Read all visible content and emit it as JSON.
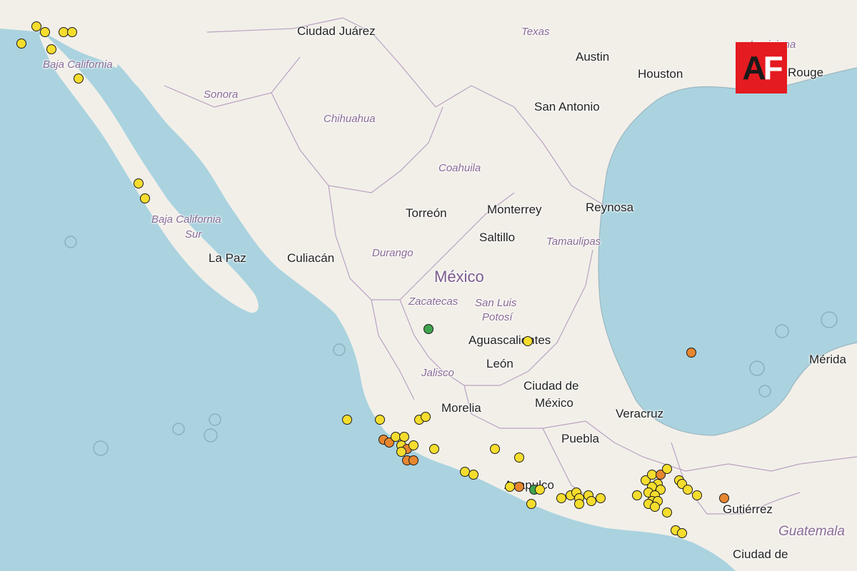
{
  "logo": {
    "text_a": "A",
    "text_f": "F",
    "color": "#e41b20"
  },
  "colors": {
    "water": "#aad3df",
    "land": "#f2efe9",
    "yellow": "#f5dd2e",
    "orange": "#e6862f",
    "green": "#3fa34d"
  },
  "labels": {
    "country_mexico": "México",
    "states": {
      "baja_california": "Baja California",
      "sonora": "Sonora",
      "chihuahua": "Chihuahua",
      "coahuila": "Coahuila",
      "texas": "Texas",
      "louisiana": "Louisiana",
      "baja_california_sur": "Baja California",
      "baja_california_sur_2": "Sur",
      "durango": "Durango",
      "tamaulipas": "Tamaulipas",
      "zacatecas": "Zacatecas",
      "san_luis_potosi": "San Luis",
      "san_luis_potosi_2": "Potosí",
      "jalisco": "Jalisco"
    },
    "cities": {
      "ciudad_juarez": "Ciudad Juárez",
      "austin": "Austin",
      "houston": "Houston",
      "baton_rouge": "Rouge",
      "san_antonio": "San Antonio",
      "torreon": "Torreón",
      "monterrey": "Monterrey",
      "reynosa": "Reynosa",
      "saltillo": "Saltillo",
      "la_paz": "La Paz",
      "culiacan": "Culiacán",
      "aguascalientes": "Aguascalientes",
      "leon": "León",
      "ciudad_de_mexico": "Ciudad de",
      "ciudad_de_mexico_2": "México",
      "morelia": "Morelia",
      "puebla": "Puebla",
      "veracruz": "Veracruz",
      "acapulco": "Acapulco",
      "merida": "Mérida",
      "tuxtla": "Gutiérrez",
      "guatemala": "Guatemala",
      "ciudad_de_guatemala": "Ciudad de"
    }
  },
  "earthquakes": [
    {
      "lat": 32.9,
      "lon": -115.8,
      "level": "yellow"
    },
    {
      "lat": 32.7,
      "lon": -115.5,
      "level": "yellow"
    },
    {
      "lat": 32.7,
      "lon": -114.9,
      "level": "yellow"
    },
    {
      "lat": 32.7,
      "lon": -114.6,
      "level": "yellow"
    },
    {
      "lat": 32.3,
      "lon": -116.3,
      "level": "yellow"
    },
    {
      "lat": 32.1,
      "lon": -115.3,
      "level": "yellow"
    },
    {
      "lat": 31.1,
      "lon": -114.4,
      "level": "yellow"
    },
    {
      "lat": 27.5,
      "lon": -112.4,
      "level": "yellow"
    },
    {
      "lat": 27.0,
      "lon": -112.2,
      "level": "yellow"
    },
    {
      "lat": 22.5,
      "lon": -102.8,
      "level": "green"
    },
    {
      "lat": 22.1,
      "lon": -99.5,
      "level": "yellow"
    },
    {
      "lat": 21.7,
      "lon": -94.1,
      "level": "orange"
    },
    {
      "lat": 19.4,
      "lon": -105.5,
      "level": "yellow"
    },
    {
      "lat": 19.4,
      "lon": -104.4,
      "level": "yellow"
    },
    {
      "lat": 19.4,
      "lon": -103.1,
      "level": "yellow"
    },
    {
      "lat": 19.5,
      "lon": -102.9,
      "level": "yellow"
    },
    {
      "lat": 18.7,
      "lon": -104.3,
      "level": "orange"
    },
    {
      "lat": 18.6,
      "lon": -104.1,
      "level": "orange"
    },
    {
      "lat": 18.8,
      "lon": -103.9,
      "level": "yellow"
    },
    {
      "lat": 18.8,
      "lon": -103.6,
      "level": "yellow"
    },
    {
      "lat": 18.5,
      "lon": -103.7,
      "level": "yellow"
    },
    {
      "lat": 18.4,
      "lon": -103.5,
      "level": "orange"
    },
    {
      "lat": 18.3,
      "lon": -103.7,
      "level": "yellow"
    },
    {
      "lat": 18.5,
      "lon": -103.3,
      "level": "yellow"
    },
    {
      "lat": 18.0,
      "lon": -103.5,
      "level": "orange"
    },
    {
      "lat": 18.0,
      "lon": -103.3,
      "level": "orange"
    },
    {
      "lat": 18.4,
      "lon": -102.6,
      "level": "yellow"
    },
    {
      "lat": 18.4,
      "lon": -100.6,
      "level": "yellow"
    },
    {
      "lat": 18.1,
      "lon": -99.8,
      "level": "yellow"
    },
    {
      "lat": 17.6,
      "lon": -101.6,
      "level": "yellow"
    },
    {
      "lat": 17.5,
      "lon": -101.3,
      "level": "yellow"
    },
    {
      "lat": 17.1,
      "lon": -100.1,
      "level": "yellow"
    },
    {
      "lat": 17.1,
      "lon": -99.8,
      "level": "orange"
    },
    {
      "lat": 17.0,
      "lon": -99.3,
      "level": "green"
    },
    {
      "lat": 17.0,
      "lon": -99.1,
      "level": "yellow"
    },
    {
      "lat": 16.5,
      "lon": -99.4,
      "level": "yellow"
    },
    {
      "lat": 16.7,
      "lon": -98.4,
      "level": "yellow"
    },
    {
      "lat": 16.8,
      "lon": -98.1,
      "level": "yellow"
    },
    {
      "lat": 16.9,
      "lon": -97.9,
      "level": "yellow"
    },
    {
      "lat": 16.7,
      "lon": -97.8,
      "level": "yellow"
    },
    {
      "lat": 16.5,
      "lon": -97.8,
      "level": "yellow"
    },
    {
      "lat": 16.8,
      "lon": -97.5,
      "level": "yellow"
    },
    {
      "lat": 16.6,
      "lon": -97.4,
      "level": "yellow"
    },
    {
      "lat": 16.7,
      "lon": -97.1,
      "level": "yellow"
    },
    {
      "lat": 16.8,
      "lon": -95.9,
      "level": "yellow"
    },
    {
      "lat": 17.3,
      "lon": -95.6,
      "level": "yellow"
    },
    {
      "lat": 17.5,
      "lon": -95.4,
      "level": "yellow"
    },
    {
      "lat": 17.5,
      "lon": -95.1,
      "level": "orange"
    },
    {
      "lat": 17.7,
      "lon": -94.9,
      "level": "yellow"
    },
    {
      "lat": 17.2,
      "lon": -95.2,
      "level": "yellow"
    },
    {
      "lat": 17.1,
      "lon": -95.4,
      "level": "yellow"
    },
    {
      "lat": 17.0,
      "lon": -95.1,
      "level": "yellow"
    },
    {
      "lat": 16.9,
      "lon": -95.5,
      "level": "yellow"
    },
    {
      "lat": 16.8,
      "lon": -95.3,
      "level": "yellow"
    },
    {
      "lat": 16.6,
      "lon": -95.4,
      "level": "yellow"
    },
    {
      "lat": 16.6,
      "lon": -95.2,
      "level": "yellow"
    },
    {
      "lat": 16.5,
      "lon": -95.5,
      "level": "yellow"
    },
    {
      "lat": 16.4,
      "lon": -95.3,
      "level": "yellow"
    },
    {
      "lat": 17.3,
      "lon": -94.5,
      "level": "yellow"
    },
    {
      "lat": 17.2,
      "lon": -94.4,
      "level": "yellow"
    },
    {
      "lat": 17.0,
      "lon": -94.2,
      "level": "yellow"
    },
    {
      "lat": 16.8,
      "lon": -93.9,
      "level": "yellow"
    },
    {
      "lat": 16.7,
      "lon": -93.0,
      "level": "orange"
    },
    {
      "lat": 16.2,
      "lon": -94.9,
      "level": "yellow"
    },
    {
      "lat": 15.6,
      "lon": -94.6,
      "level": "yellow"
    },
    {
      "lat": 15.5,
      "lon": -94.4,
      "level": "yellow"
    }
  ]
}
